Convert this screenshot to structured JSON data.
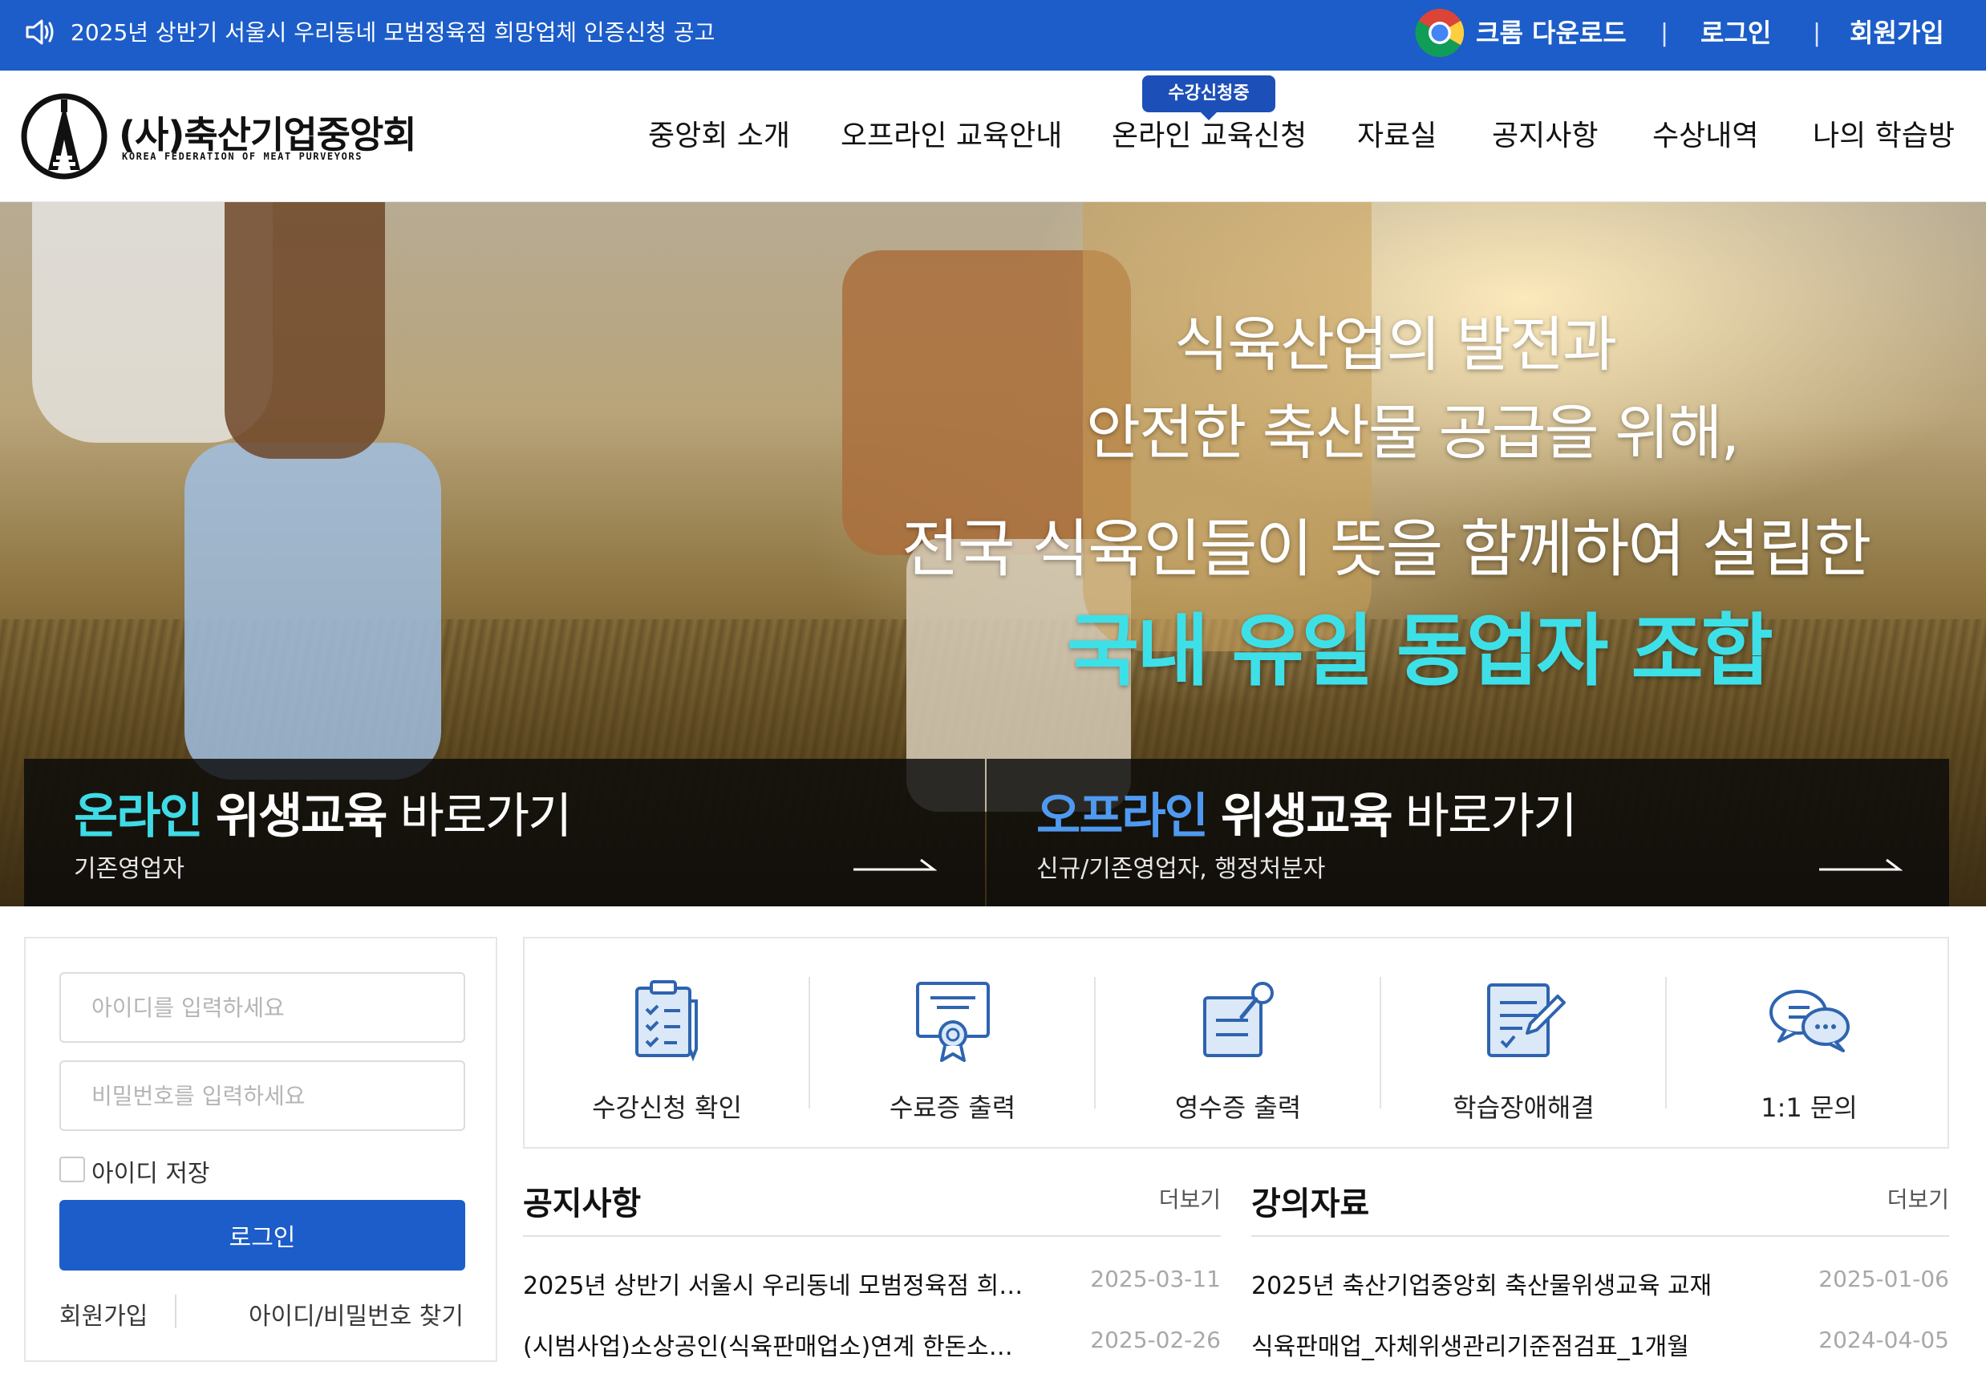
{
  "topbar": {
    "notice": "2025년 상반기 서울시 우리동네 모범정육점 희망업체 인증신청 공고",
    "chrome_download": "크롬 다운로드",
    "separator": "|",
    "login": "로그인",
    "signup": "회원가입"
  },
  "header": {
    "logo_title": "(사)축산기업중앙회",
    "logo_subtitle": "KOREA FEDERATION OF MEAT PURVEYORS",
    "nav": [
      "중앙회 소개",
      "오프라인 교육안내",
      "온라인 교육신청",
      "자료실",
      "공지사항",
      "수상내역",
      "나의 학습방"
    ],
    "nav_badge": "수강신청중"
  },
  "hero": {
    "line1": "식육산업의 발전과",
    "line2": "안전한 축산물 공급을 위해,",
    "line3": "전국 식육인들이 뜻을 함께하여 설립한",
    "line4": "국내 유일 동업자 조합"
  },
  "quick_panels": {
    "online": {
      "accent": "온라인",
      "strong": "위생교육",
      "rest": "바로가기",
      "sub": "기존영업자"
    },
    "offline": {
      "accent": "오프라인",
      "strong": "위생교육",
      "rest": "바로가기",
      "sub": "신규/기존영업자, 행정처분자"
    }
  },
  "login": {
    "id_placeholder": "아이디를 입력하세요",
    "pw_placeholder": "비밀번호를 입력하세요",
    "save_id": "아이디 저장",
    "button": "로그인",
    "signup": "회원가입",
    "find": "아이디/비밀번호 찾기"
  },
  "quick_menu": [
    {
      "label": "수강신청 확인",
      "icon": "clipboard-check-icon"
    },
    {
      "label": "수료증 출력",
      "icon": "certificate-icon"
    },
    {
      "label": "영수증 출력",
      "icon": "receipt-pin-icon"
    },
    {
      "label": "학습장애해결",
      "icon": "document-edit-icon"
    },
    {
      "label": "1:1 문의",
      "icon": "chat-bubbles-icon"
    }
  ],
  "notice_board": {
    "title": "공지사항",
    "more": "더보기",
    "rows": [
      {
        "title": "2025년 상반기 서울시 우리동네 모범정육점 희…",
        "date": "2025-03-11"
      },
      {
        "title": "(시범사업)소상공인(식육판매업소)연계 한돈소…",
        "date": "2025-02-26"
      }
    ]
  },
  "lecture_board": {
    "title": "강의자료",
    "more": "더보기",
    "rows": [
      {
        "title": "2025년 축산기업중앙회 축산물위생교육 교재",
        "date": "2025-01-06"
      },
      {
        "title": "식육판매업_자체위생관리기준점검표_1개월",
        "date": "2024-04-05"
      }
    ]
  },
  "colors": {
    "brand_blue": "#1c5dc9",
    "badge_blue": "#1c4fb8",
    "hero_cyan": "#3ee0e8",
    "offline_blue": "#4f9af0",
    "icon_blue": "#2e64b0"
  }
}
